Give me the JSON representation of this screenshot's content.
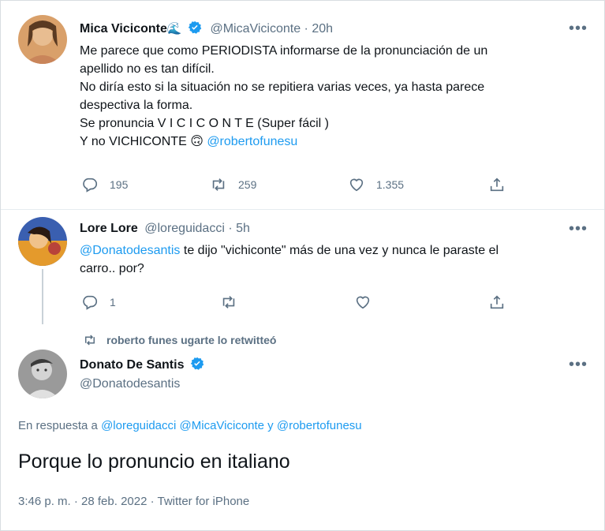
{
  "tweet1": {
    "name": "Mica Viciconte",
    "name_emoji": "🌊",
    "handle_time": "@MicaViciconte · 20h",
    "lines": [
      "Me parece que como PERIODISTA informarse de la pronunciación de un",
      "apellido no es tan difícil.",
      "No diría esto si la situación no se repitiera varias veces, ya hasta parece",
      "despectiva la forma.",
      "Se pronuncia V I C I C O N T E (Super fácil )"
    ],
    "last_line_text": "Y no VICHICONTE 🙃 ",
    "last_line_mention": "@robertofunesu",
    "replies": "195",
    "retweets": "259",
    "likes": "1.355"
  },
  "tweet2": {
    "name": "Lore Lore",
    "handle_time": "@loreguidacci · 5h",
    "mention": "@Donatodesantis",
    "line1_rest": " te dijo \"vichiconte\" más de una vez y nunca le paraste el",
    "line2": "carro.. por?",
    "replies": "1",
    "retweets": "",
    "likes": ""
  },
  "retweet_banner": "roberto funes ugarte lo retwitteó",
  "tweet3": {
    "name": "Donato De Santis",
    "handle": "@Donatodesantis",
    "reply_prefix": "En respuesta a ",
    "reply_mentions": "@loreguidacci @MicaViciconte y @robertofunesu",
    "text": "Porque lo pronuncio en italiano",
    "meta": "3:46 p. m. · 28 feb. 2022 · Twitter for iPhone"
  },
  "icons": [
    "reply-icon",
    "retweet-icon",
    "like-icon",
    "share-icon",
    "verified-icon",
    "more-icon"
  ],
  "colors": {
    "link": "#1d9bf0",
    "muted": "#5b7083",
    "text": "#0f1419"
  }
}
